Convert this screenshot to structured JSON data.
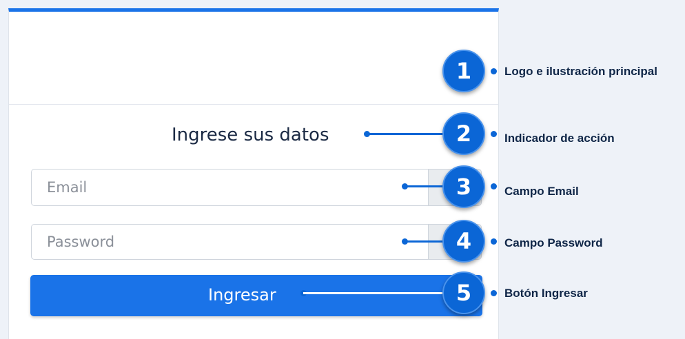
{
  "login": {
    "heading": "Ingrese sus datos",
    "email_placeholder": "Email",
    "password_placeholder": "Password",
    "submit_label": "Ingresar"
  },
  "annotations": [
    {
      "number": "1",
      "label": "Logo e ilustración principal"
    },
    {
      "number": "2",
      "label": "Indicador de acción"
    },
    {
      "number": "3",
      "label": "Campo Email"
    },
    {
      "number": "4",
      "label": "Campo Password"
    },
    {
      "number": "5",
      "label": "Botón Ingresar"
    }
  ],
  "colors": {
    "accent": "#1a73e8",
    "annotation": "#0b66d6"
  }
}
